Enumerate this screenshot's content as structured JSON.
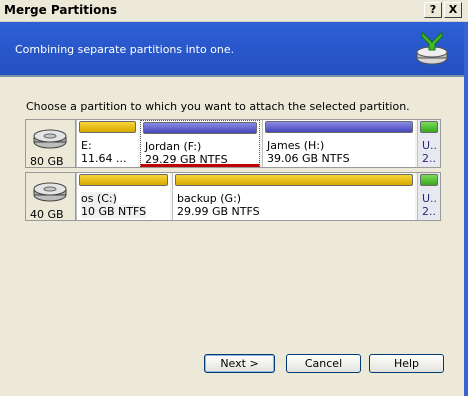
{
  "window": {
    "title": "Merge Partitions",
    "help_button": "?",
    "close_button": "X"
  },
  "banner": {
    "subtitle": "Combining separate partitions into one.",
    "icon": "merge-wizard-icon"
  },
  "instruction": "Choose a partition to which you want to attach the selected partition.",
  "disks": [
    {
      "size": "80 GB",
      "partitions": [
        {
          "line1": "E:",
          "line2": "11.64 ...",
          "color": "yellow"
        },
        {
          "line1": "Jordan (F:)",
          "line2": "29.29 GB  NTFS",
          "color": "blue",
          "selected": true
        },
        {
          "line1": "James (H:)",
          "line2": "39.06 GB  NTFS",
          "color": "blue"
        },
        {
          "line1": "U..",
          "line2": "2..",
          "color": "green"
        }
      ]
    },
    {
      "size": "40 GB",
      "partitions": [
        {
          "line1": "os (C:)",
          "line2": "10 GB  NTFS",
          "color": "yellow"
        },
        {
          "line1": "backup (G:)",
          "line2": "29.99 GB  NTFS",
          "color": "yellow"
        },
        {
          "line1": "U..",
          "line2": "2..",
          "color": "green"
        }
      ]
    }
  ],
  "buttons": {
    "next": "Next >",
    "cancel": "Cancel",
    "help": "Help"
  },
  "colors": {
    "banner": "#2450c0",
    "yellow_bar": "#f5d53a",
    "blue_bar": "#5a5ad0",
    "green_bar": "#4cc02e",
    "selection_underline": "#c00000"
  }
}
